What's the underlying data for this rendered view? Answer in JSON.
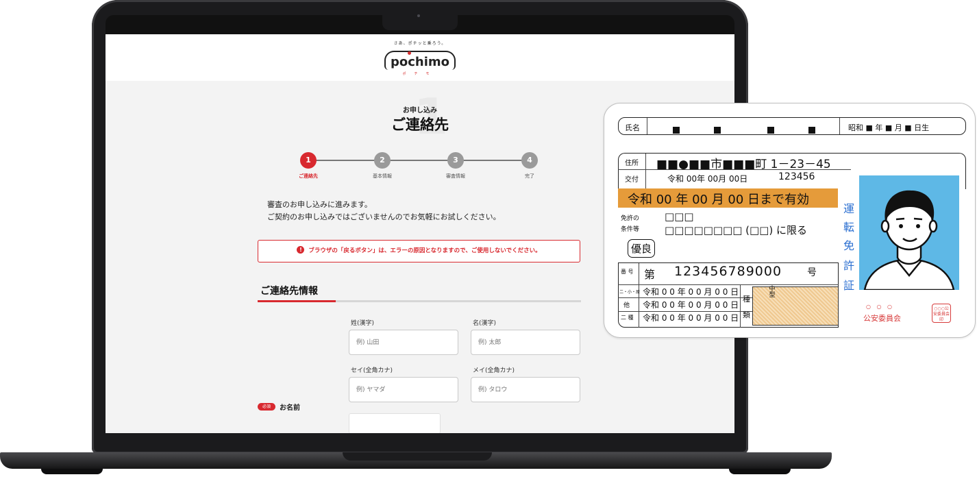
{
  "site": {
    "tagline": "さあ、ポチッと乗ろう。",
    "logo": "pochimo",
    "logo_sub": "ポチモ"
  },
  "page": {
    "subtitle": "お申し込み",
    "title": "ご連絡先",
    "steps": [
      {
        "num": "1",
        "label": "ご連絡先",
        "active": true
      },
      {
        "num": "2",
        "label": "基本情報",
        "active": false
      },
      {
        "num": "3",
        "label": "審査情報",
        "active": false
      },
      {
        "num": "4",
        "label": "完了",
        "active": false
      }
    ],
    "intro_line1": "審査のお申し込みに進みます。",
    "intro_line2": "ご契約のお申し込みではございませんのでお気軽にお試しください。",
    "alert": "ブラウザの「戻るボタン」は、エラーの原因となりますので、ご使用しないでください。",
    "alert_icon": "!",
    "section_title": "ご連絡先情報",
    "required_badge": "必須",
    "name_label": "お名前",
    "fields": {
      "sei_label": "姓(漢字)",
      "sei_placeholder": "例) 山田",
      "mei_label": "名(漢字)",
      "mei_placeholder": "例) 太郎",
      "sei_kana_label": "セイ(全角カナ)",
      "sei_kana_placeholder": "例) ヤマダ",
      "mei_kana_label": "メイ(全角カナ)",
      "mei_kana_placeholder": "例) タロウ"
    }
  },
  "license": {
    "name_label": "氏名",
    "birth": "昭和 ■ 年 ■ 月 ■ 日生",
    "address_label": "住所",
    "address": "■■●■■市■■■町 1－23－45",
    "issue_label": "交付",
    "issue_date": "令和 00年 00月 00日",
    "issue_number": "123456",
    "valid_until": "令和 00 年 00 月 00 日まで有効",
    "conditions_label_1": "免許の",
    "conditions_label_2": "条件等",
    "conditions_line1": "□□□",
    "conditions_line2": "□□□□□□□□ (□□) に限る",
    "excellent": "優良",
    "number_label": "番 号",
    "number_prefix": "第",
    "number": "123456789000",
    "number_suffix": "号",
    "dates_labels": [
      "二・小・原",
      "他",
      "二 種"
    ],
    "dates": [
      "令和 0 0 年 0 0 月 0 0 日",
      "令和 0 0 年 0 0 月 0 0 日",
      "令和 0 0 年 0 0 月 0 0 日"
    ],
    "type_label_top": "種",
    "type_label_bottom": "類",
    "type_chugata": "中型",
    "vertical_title": [
      "運",
      "転",
      "免",
      "許",
      "証"
    ],
    "commission": "公安委員会",
    "commission_circles": "○ ○ ○",
    "seal_text": "○○○公安委員会印"
  },
  "colors": {
    "accent": "#d8292f",
    "valid_bar": "#e59b3a",
    "photo_bg": "#5eb8e6",
    "license_blue": "#2b6fd1"
  }
}
